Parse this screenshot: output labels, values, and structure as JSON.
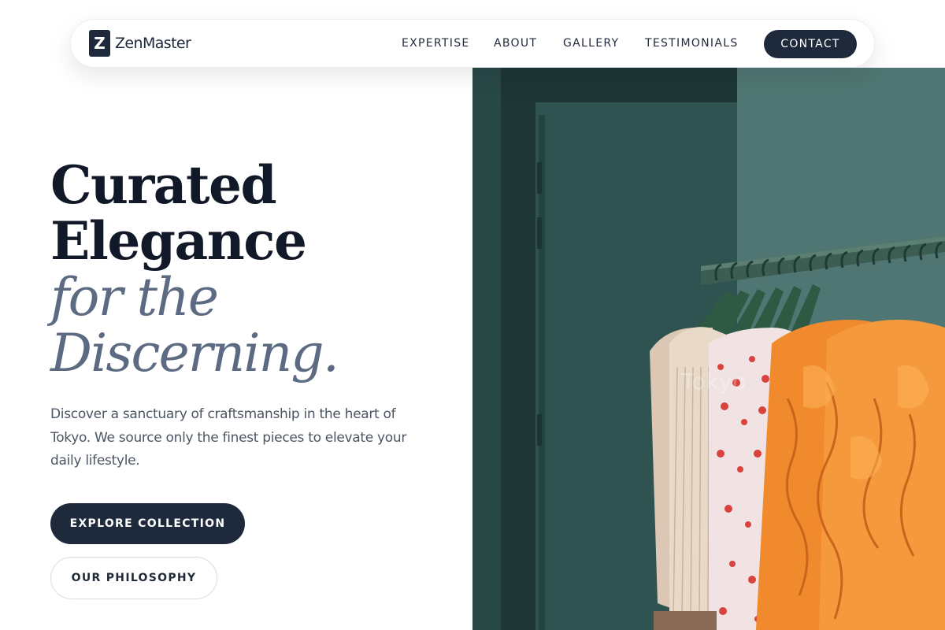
{
  "brand": {
    "mark": "Z",
    "name": "ZenMaster"
  },
  "nav": {
    "links": [
      "EXPERTISE",
      "ABOUT",
      "GALLERY",
      "TESTIMONIALS"
    ],
    "cta": "CONTACT"
  },
  "hero": {
    "headline_line1": "Curated",
    "headline_line2": "Elegance",
    "headline_line3": "for the",
    "headline_line4": "Discerning.",
    "description": "Discover a sanctuary of craftsmanship in the heart of Tokyo. We source only the finest pieces to elevate your daily lifestyle.",
    "primary_button": "EXPLORE COLLECTION",
    "secondary_button": "OUR PHILOSOPHY",
    "image_caption": "Tokyo"
  },
  "colors": {
    "navy": "#1e293b",
    "headline": "#111827",
    "headline_italic": "#5c6b82",
    "body_text": "#4b5563"
  }
}
